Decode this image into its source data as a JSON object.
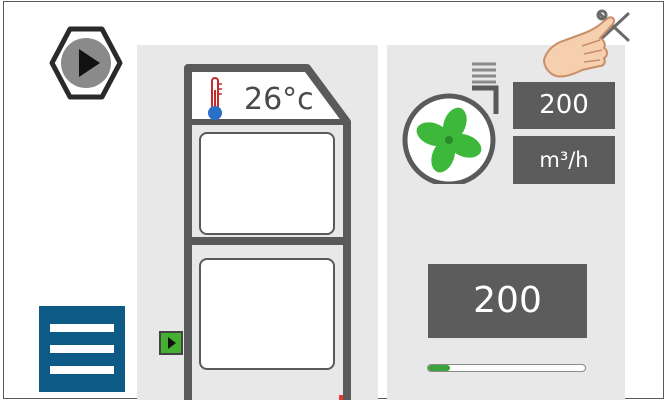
{
  "cabinet": {
    "temperature": "26°c",
    "thermometer_icon": "thermometer-icon"
  },
  "controls": {
    "play_icon": "play-icon",
    "menu_icon": "hamburger-menu-icon",
    "entry_icon": "door-entry-icon"
  },
  "fan": {
    "icon": "fan-icon",
    "airflow_value": "200",
    "airflow_unit": "m³/h"
  },
  "main_display": {
    "value": "200",
    "progress_fraction": 0.14
  },
  "overlay": {
    "cursor_icon": "hand-pointer-icon",
    "settings_icon": "wrench-icon"
  },
  "colors": {
    "menu_bg": "#0e5a86",
    "fan_green": "#3db83b",
    "value_box_bg": "#5c5c5c",
    "panel_bg": "#e8e8e8",
    "progress_fill": "#3aa23a"
  }
}
